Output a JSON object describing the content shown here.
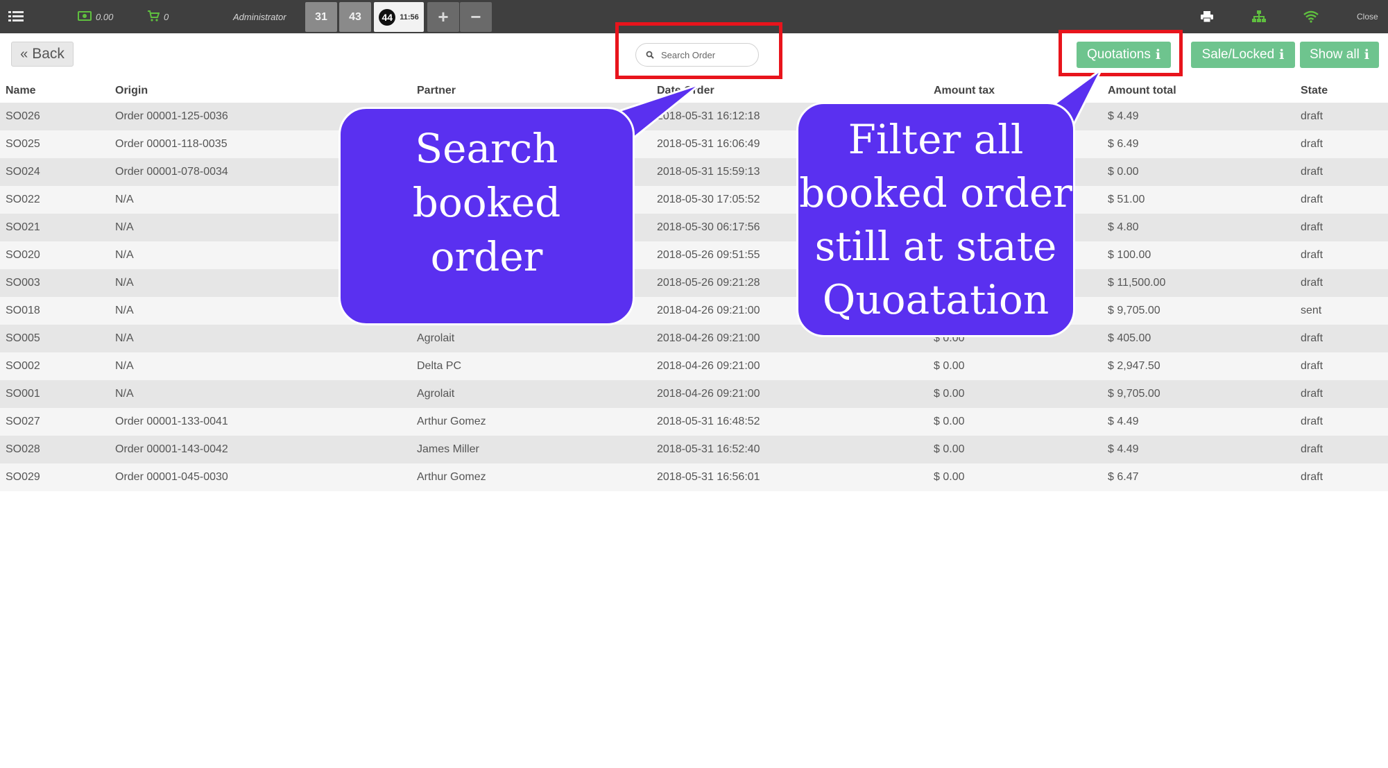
{
  "topbar": {
    "cash_value": "0.00",
    "cart_value": "0",
    "user": "Administrator",
    "tabs": [
      {
        "label": "31"
      },
      {
        "label": "43"
      },
      {
        "label": "44",
        "time": "11:56"
      }
    ],
    "add_label": "+",
    "remove_label": "−",
    "close_label": "Close",
    "icons": [
      "list-icon",
      "money-icon",
      "cart-icon",
      "print-icon",
      "sitemap-icon",
      "wifi-icon"
    ],
    "colors": {
      "bar": "#3f3f3f",
      "accent_green": "#5fbf3f"
    }
  },
  "controls": {
    "back_label": "Back",
    "search_placeholder": "Search Order",
    "filters": [
      {
        "label": "Quotations",
        "info": "i"
      },
      {
        "label": "Sale/Locked",
        "info": "i"
      },
      {
        "label": "Show all",
        "info": "i"
      }
    ],
    "filter_color": "#6ec48e"
  },
  "table": {
    "columns": [
      "Name",
      "Origin",
      "Partner",
      "Date Order",
      "Amount tax",
      "Amount total",
      "State"
    ],
    "rows": [
      [
        "SO026",
        "Order 00001-125-0036",
        "",
        "2018-05-31 16:12:18",
        "",
        "$ 4.49",
        "draft"
      ],
      [
        "SO025",
        "Order 00001-118-0035",
        "",
        "2018-05-31 16:06:49",
        "",
        "$ 6.49",
        "draft"
      ],
      [
        "SO024",
        "Order 00001-078-0034",
        "",
        "2018-05-31 15:59:13",
        "",
        "$ 0.00",
        "draft"
      ],
      [
        "SO022",
        "N/A",
        "",
        "2018-05-30 17:05:52",
        "",
        "$ 51.00",
        "draft"
      ],
      [
        "SO021",
        "N/A",
        "",
        "2018-05-30 06:17:56",
        "",
        "$ 4.80",
        "draft"
      ],
      [
        "SO020",
        "N/A",
        "",
        "2018-05-26 09:51:55",
        "",
        "$ 100.00",
        "draft"
      ],
      [
        "SO003",
        "N/A",
        "",
        "2018-05-26 09:21:28",
        "",
        "$ 11,500.00",
        "draft"
      ],
      [
        "SO018",
        "N/A",
        "",
        "2018-04-26 09:21:00",
        "",
        "$ 9,705.00",
        "sent"
      ],
      [
        "SO005",
        "N/A",
        "Agrolait",
        "2018-04-26 09:21:00",
        "$ 0.00",
        "$ 405.00",
        "draft"
      ],
      [
        "SO002",
        "N/A",
        "Delta PC",
        "2018-04-26 09:21:00",
        "$ 0.00",
        "$ 2,947.50",
        "draft"
      ],
      [
        "SO001",
        "N/A",
        "Agrolait",
        "2018-04-26 09:21:00",
        "$ 0.00",
        "$ 9,705.00",
        "draft"
      ],
      [
        "SO027",
        "Order 00001-133-0041",
        "Arthur Gomez",
        "2018-05-31 16:48:52",
        "$ 0.00",
        "$ 4.49",
        "draft"
      ],
      [
        "SO028",
        "Order 00001-143-0042",
        "James Miller",
        "2018-05-31 16:52:40",
        "$ 0.00",
        "$ 4.49",
        "draft"
      ],
      [
        "SO029",
        "Order 00001-045-0030",
        "Arthur Gomez",
        "2018-05-31 16:56:01",
        "$ 0.00",
        "$ 6.47",
        "draft"
      ]
    ]
  },
  "annotations": {
    "search_callout": [
      "Search booked",
      "order"
    ],
    "filter_callout": [
      "Filter all",
      "booked order",
      "still at state",
      "Quoatation"
    ],
    "highlight_color": "#e8141c",
    "callout_color": "#5a30f0"
  }
}
